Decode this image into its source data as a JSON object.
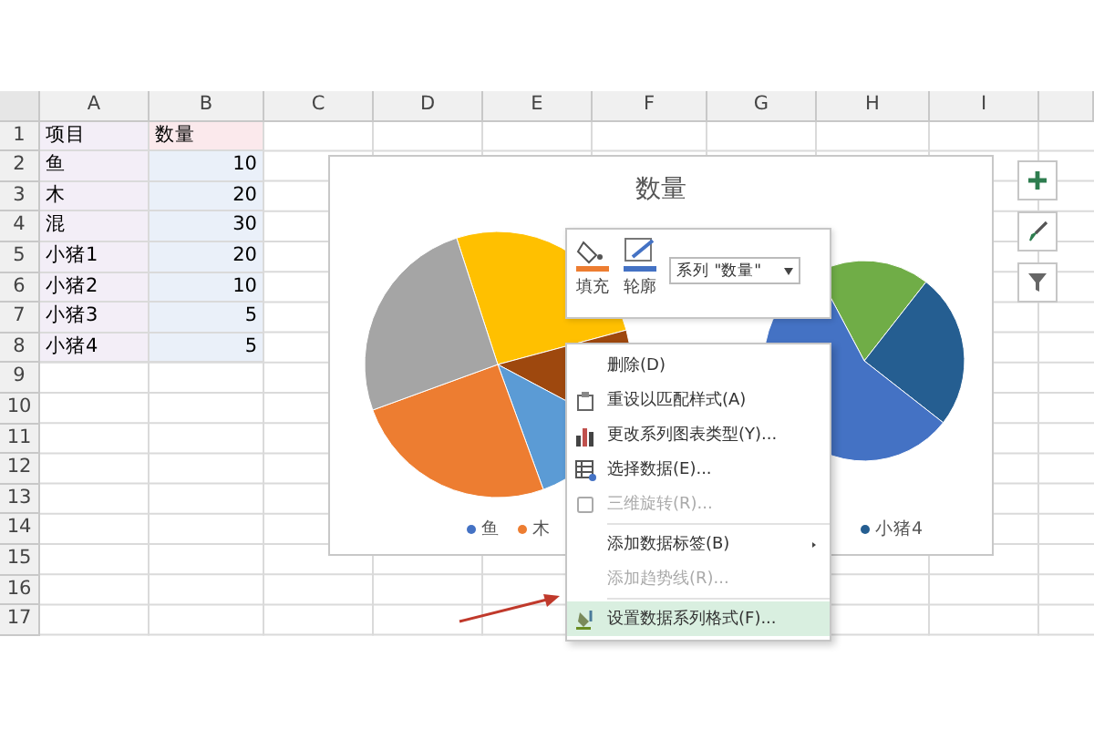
{
  "sheet": {
    "columns": [
      "A",
      "B",
      "C",
      "D",
      "E",
      "F",
      "G",
      "H",
      "I"
    ],
    "rows": [
      {
        "number": "1",
        "cells": [
          "项目",
          "数量"
        ]
      },
      {
        "number": "2",
        "cells": [
          "鱼",
          "10"
        ]
      },
      {
        "number": "3",
        "cells": [
          "木",
          "20"
        ]
      },
      {
        "number": "4",
        "cells": [
          "混",
          "30"
        ]
      },
      {
        "number": "5",
        "cells": [
          "小猪1",
          "20"
        ]
      },
      {
        "number": "6",
        "cells": [
          "小猪2",
          "10"
        ]
      },
      {
        "number": "7",
        "cells": [
          "小猪3",
          "5"
        ]
      },
      {
        "number": "8",
        "cells": [
          "小猪4",
          "5"
        ]
      },
      {
        "number": "9",
        "cells": []
      },
      {
        "number": "10",
        "cells": []
      },
      {
        "number": "11",
        "cells": []
      },
      {
        "number": "12",
        "cells": []
      },
      {
        "number": "13",
        "cells": []
      },
      {
        "number": "14",
        "cells": []
      },
      {
        "number": "15",
        "cells": []
      },
      {
        "number": "16",
        "cells": []
      },
      {
        "number": "17",
        "cells": []
      }
    ]
  },
  "chart": {
    "title": "数量",
    "legend": [
      {
        "label": "鱼",
        "color": "#4472c4"
      },
      {
        "label": "木",
        "color": "#ed7d31"
      },
      {
        "label": "小猪4",
        "color": "#255e91"
      }
    ]
  },
  "mini_toolbar": {
    "fill": "填充",
    "outline": "轮廓",
    "series_dropdown": "系列 \"数量\""
  },
  "context_menu": [
    {
      "label": "删除(D)",
      "disabled": false,
      "selected": false,
      "submenu": false
    },
    {
      "label": "重设以匹配样式(A)",
      "disabled": false,
      "selected": false,
      "submenu": false
    },
    {
      "label": "更改系列图表类型(Y)...",
      "disabled": false,
      "selected": false,
      "submenu": false
    },
    {
      "label": "选择数据(E)...",
      "disabled": false,
      "selected": false,
      "submenu": false
    },
    {
      "label": "三维旋转(R)...",
      "disabled": true,
      "selected": false,
      "submenu": false
    },
    {
      "label": "添加数据标签(B)",
      "disabled": false,
      "selected": false,
      "submenu": true
    },
    {
      "label": "添加趋势线(R)...",
      "disabled": true,
      "selected": false,
      "submenu": false
    },
    {
      "label": "设置数据系列格式(F)...",
      "disabled": false,
      "selected": true,
      "submenu": false
    }
  ]
}
